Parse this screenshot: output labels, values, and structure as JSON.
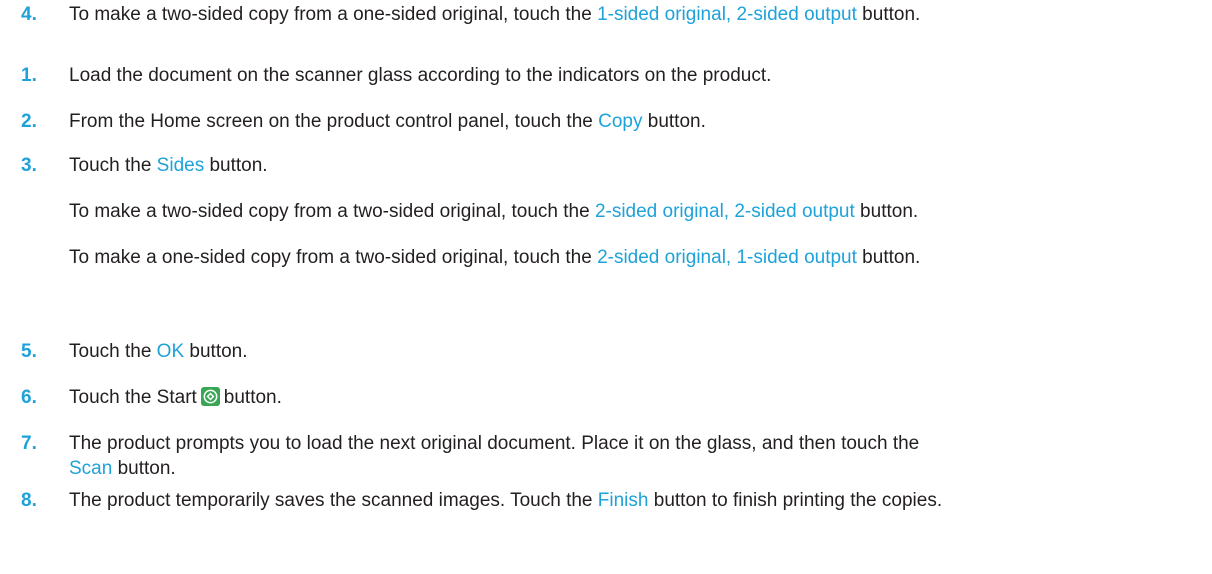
{
  "steps": [
    {
      "number": "1.",
      "parts": [
        {
          "t": "Load the document on the scanner glass according to the indicators on the product."
        }
      ]
    },
    {
      "number": "2.",
      "parts": [
        {
          "t": "From the Home screen on the product control panel, touch the "
        },
        {
          "t": "Copy",
          "link": true
        },
        {
          "t": " button."
        }
      ]
    },
    {
      "number": "3.",
      "parts": [
        {
          "t": "Touch the "
        },
        {
          "t": "Sides",
          "link": true
        },
        {
          "t": " button."
        }
      ]
    },
    {
      "number": "4.",
      "parts": [
        {
          "t": "To make a two-sided copy from a one-sided original, touch the "
        },
        {
          "t": "1-sided original, 2-sided output",
          "link": true
        },
        {
          "t": " button."
        }
      ],
      "sub": [
        [
          {
            "t": "To make a two-sided copy from a two-sided original, touch the "
          },
          {
            "t": "2-sided original, 2-sided output",
            "link": true
          },
          {
            "t": " button."
          }
        ],
        [
          {
            "t": "To make a one-sided copy from a two-sided original, touch the "
          },
          {
            "t": "2-sided original, 1-sided output",
            "link": true
          },
          {
            "t": " button."
          }
        ]
      ]
    },
    {
      "number": "5.",
      "parts": [
        {
          "t": "Touch the "
        },
        {
          "t": "OK",
          "link": true
        },
        {
          "t": " button."
        }
      ]
    },
    {
      "number": "6.",
      "parts": [
        {
          "t": "Touch the Start"
        },
        {
          "icon": "start-icon"
        },
        {
          "t": "button."
        }
      ]
    },
    {
      "number": "7.",
      "parts": [
        {
          "t": "The product prompts you to load the next original document. Place it on the glass, and then touch the"
        }
      ],
      "cont": [
        {
          "t": "Scan",
          "link": true
        },
        {
          "t": " button."
        }
      ]
    },
    {
      "number": "8.",
      "parts": [
        {
          "t": "The product temporarily saves the scanned images. Touch the "
        },
        {
          "t": "Finish",
          "link": true
        },
        {
          "t": " button to finish printing the copies."
        }
      ]
    }
  ],
  "colors": {
    "accent": "#1ea2d9",
    "text": "#231f20",
    "start_icon_fill": "#3aa655"
  }
}
